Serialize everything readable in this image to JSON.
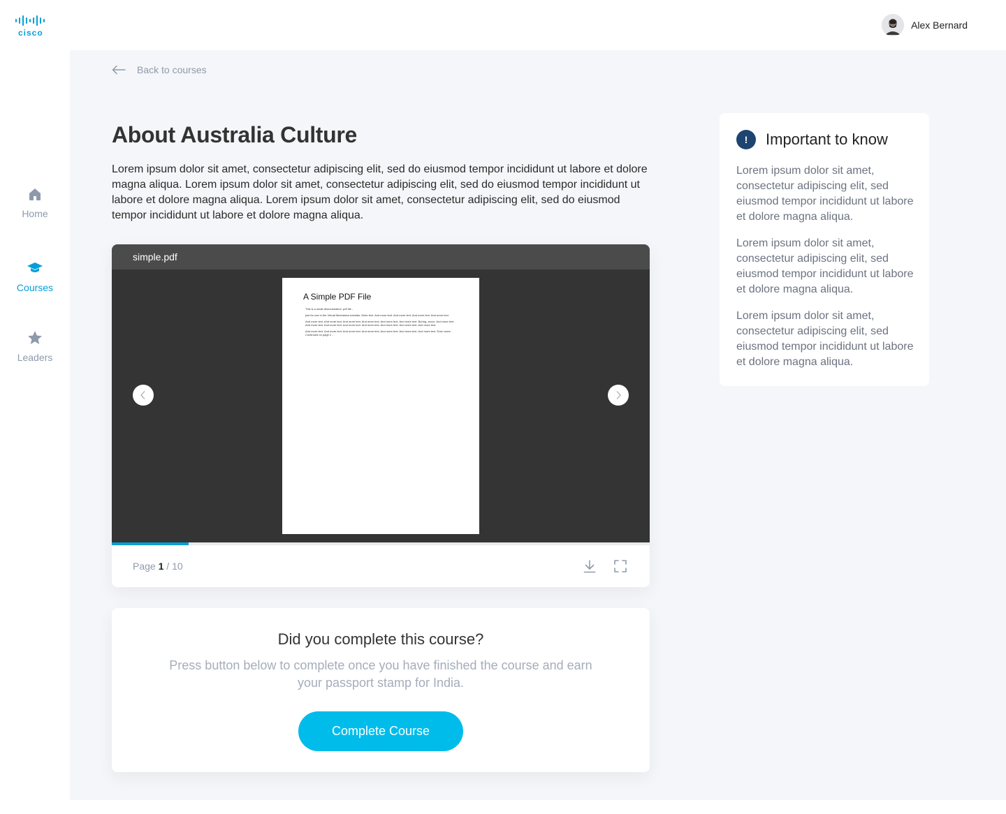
{
  "brand": {
    "name": "cisco",
    "color": "#049fd9"
  },
  "sidebar": {
    "items": [
      {
        "label": "Home",
        "icon": "home-icon",
        "active": false
      },
      {
        "label": "Courses",
        "icon": "graduation-cap-icon",
        "active": true
      },
      {
        "label": "Leaders",
        "icon": "star-icon",
        "active": false
      }
    ]
  },
  "header": {
    "user_name": "Alex Bernard"
  },
  "back": {
    "label": "Back to courses"
  },
  "course": {
    "title": "About Australia Culture",
    "description": "Lorem ipsum dolor sit amet, consectetur adipiscing elit, sed do eiusmod tempor incididunt ut labore et dolore magna aliqua. Lorem ipsum dolor sit amet, consectetur adipiscing elit, sed do eiusmod tempor incididunt ut labore et dolore magna aliqua. Lorem ipsum dolor sit amet, consectetur adipiscing elit, sed do eiusmod tempor incididunt ut labore et dolore magna aliqua."
  },
  "viewer": {
    "file_name": "simple.pdf",
    "page_label": "Page",
    "current_page": "1",
    "separator": "/",
    "total_pages": "10",
    "progress": 0.143,
    "pdf": {
      "title": "A Simple PDF File",
      "paragraphs": [
        "This is a small demonstration .pdf file -",
        "just for use in the Virtual Mechanics tutorials. More text. And more text. And more text. And more text. And more text.",
        "And more text. And more text. And more text. And more text. And more text. And more text. Boring, zzzzz. And more text. And more text. And more text. And more text. And more text. And more text. And more text. And more text.",
        "And more text. And more text. And more text. And more text. And more text. And more text. And more text. Even more. Continued on page 2 ..."
      ]
    }
  },
  "completion": {
    "title": "Did you complete this course?",
    "text": "Press button below to complete once you have finished the course and earn your passport stamp for India.",
    "button_label": "Complete Course"
  },
  "info": {
    "badge": "!",
    "title": "Important to know",
    "paragraphs": [
      "Lorem ipsum dolor sit amet, consectetur adipiscing elit, sed eiusmod tempor incididunt ut labore et dolore magna aliqua.",
      "Lorem ipsum dolor sit amet, consectetur adipiscing elit, sed eiusmod tempor incididunt ut labore et dolore magna aliqua.",
      "Lorem ipsum dolor sit amet, consectetur adipiscing elit, sed eiusmod tempor incididunt ut labore et dolore magna aliqua."
    ]
  },
  "colors": {
    "accent": "#00bceb",
    "muted": "#8e9aab",
    "info_badge": "#1e4471"
  }
}
